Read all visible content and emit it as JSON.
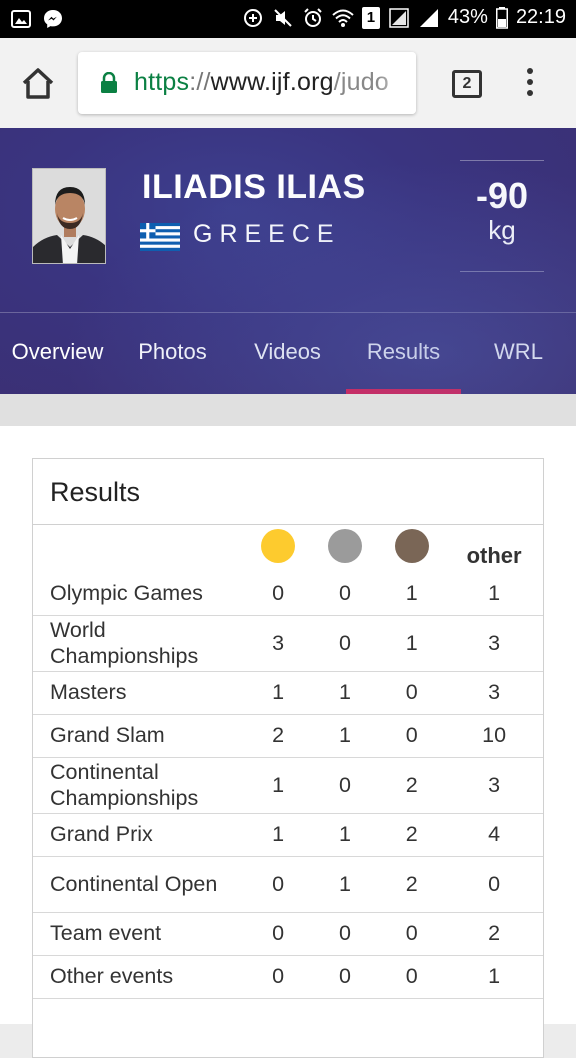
{
  "status_bar": {
    "battery_percent": "43%",
    "time": "22:19",
    "sim_badge": "1"
  },
  "browser": {
    "url_scheme": "https",
    "url_separator": "://",
    "url_host": "www.ijf.org",
    "url_path": "/judo",
    "tab_count": "2"
  },
  "athlete": {
    "name": "ILIADIS ILIAS",
    "country": "GREECE",
    "weight_value": "-90",
    "weight_unit": "kg"
  },
  "nav": {
    "items": [
      {
        "label": "Overview"
      },
      {
        "label": "Photos"
      },
      {
        "label": "Videos"
      },
      {
        "label": "Results"
      },
      {
        "label": "WRL"
      }
    ],
    "active": "Results"
  },
  "results": {
    "title": "Results",
    "header_other": "other",
    "medal_colors": {
      "gold": "#fdcb2e",
      "silver": "#9b9b9b",
      "bronze": "#7a6656"
    },
    "accent_color": "#e8194a",
    "rows": [
      {
        "event": "Olympic Games",
        "gold": "0",
        "silver": "0",
        "bronze": "1",
        "other": "1"
      },
      {
        "event": "World Championships",
        "gold": "3",
        "silver": "0",
        "bronze": "1",
        "other": "3"
      },
      {
        "event": "Masters",
        "gold": "1",
        "silver": "1",
        "bronze": "0",
        "other": "3"
      },
      {
        "event": "Grand Slam",
        "gold": "2",
        "silver": "1",
        "bronze": "0",
        "other": "10"
      },
      {
        "event": "Continental Championships",
        "gold": "1",
        "silver": "0",
        "bronze": "2",
        "other": "3"
      },
      {
        "event": "Grand Prix",
        "gold": "1",
        "silver": "1",
        "bronze": "2",
        "other": "4"
      },
      {
        "event": "Continental Open",
        "gold": "0",
        "silver": "1",
        "bronze": "2",
        "other": "0"
      },
      {
        "event": "Team event",
        "gold": "0",
        "silver": "0",
        "bronze": "0",
        "other": "2"
      },
      {
        "event": "Other events",
        "gold": "0",
        "silver": "0",
        "bronze": "0",
        "other": "1"
      }
    ]
  }
}
